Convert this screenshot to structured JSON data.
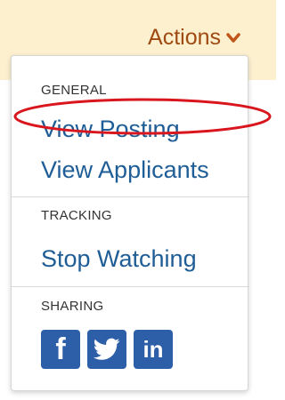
{
  "header": {
    "actions_label": "Actions"
  },
  "menu": {
    "general_heading": "GENERAL",
    "view_posting": "View Posting",
    "view_applicants": "View Applicants",
    "tracking_heading": "TRACKING",
    "stop_watching": "Stop Watching",
    "sharing_heading": "SHARING",
    "social": [
      {
        "name": "facebook",
        "glyph": "f"
      },
      {
        "name": "twitter",
        "glyph": ""
      },
      {
        "name": "linkedin",
        "glyph": "in"
      }
    ]
  },
  "colors": {
    "topbar_bg": "#fcf0cf",
    "actions_text": "#9e4a12",
    "link": "#1f5d96",
    "social_bg": "#2d5ea8",
    "annotation": "#d9161d"
  }
}
